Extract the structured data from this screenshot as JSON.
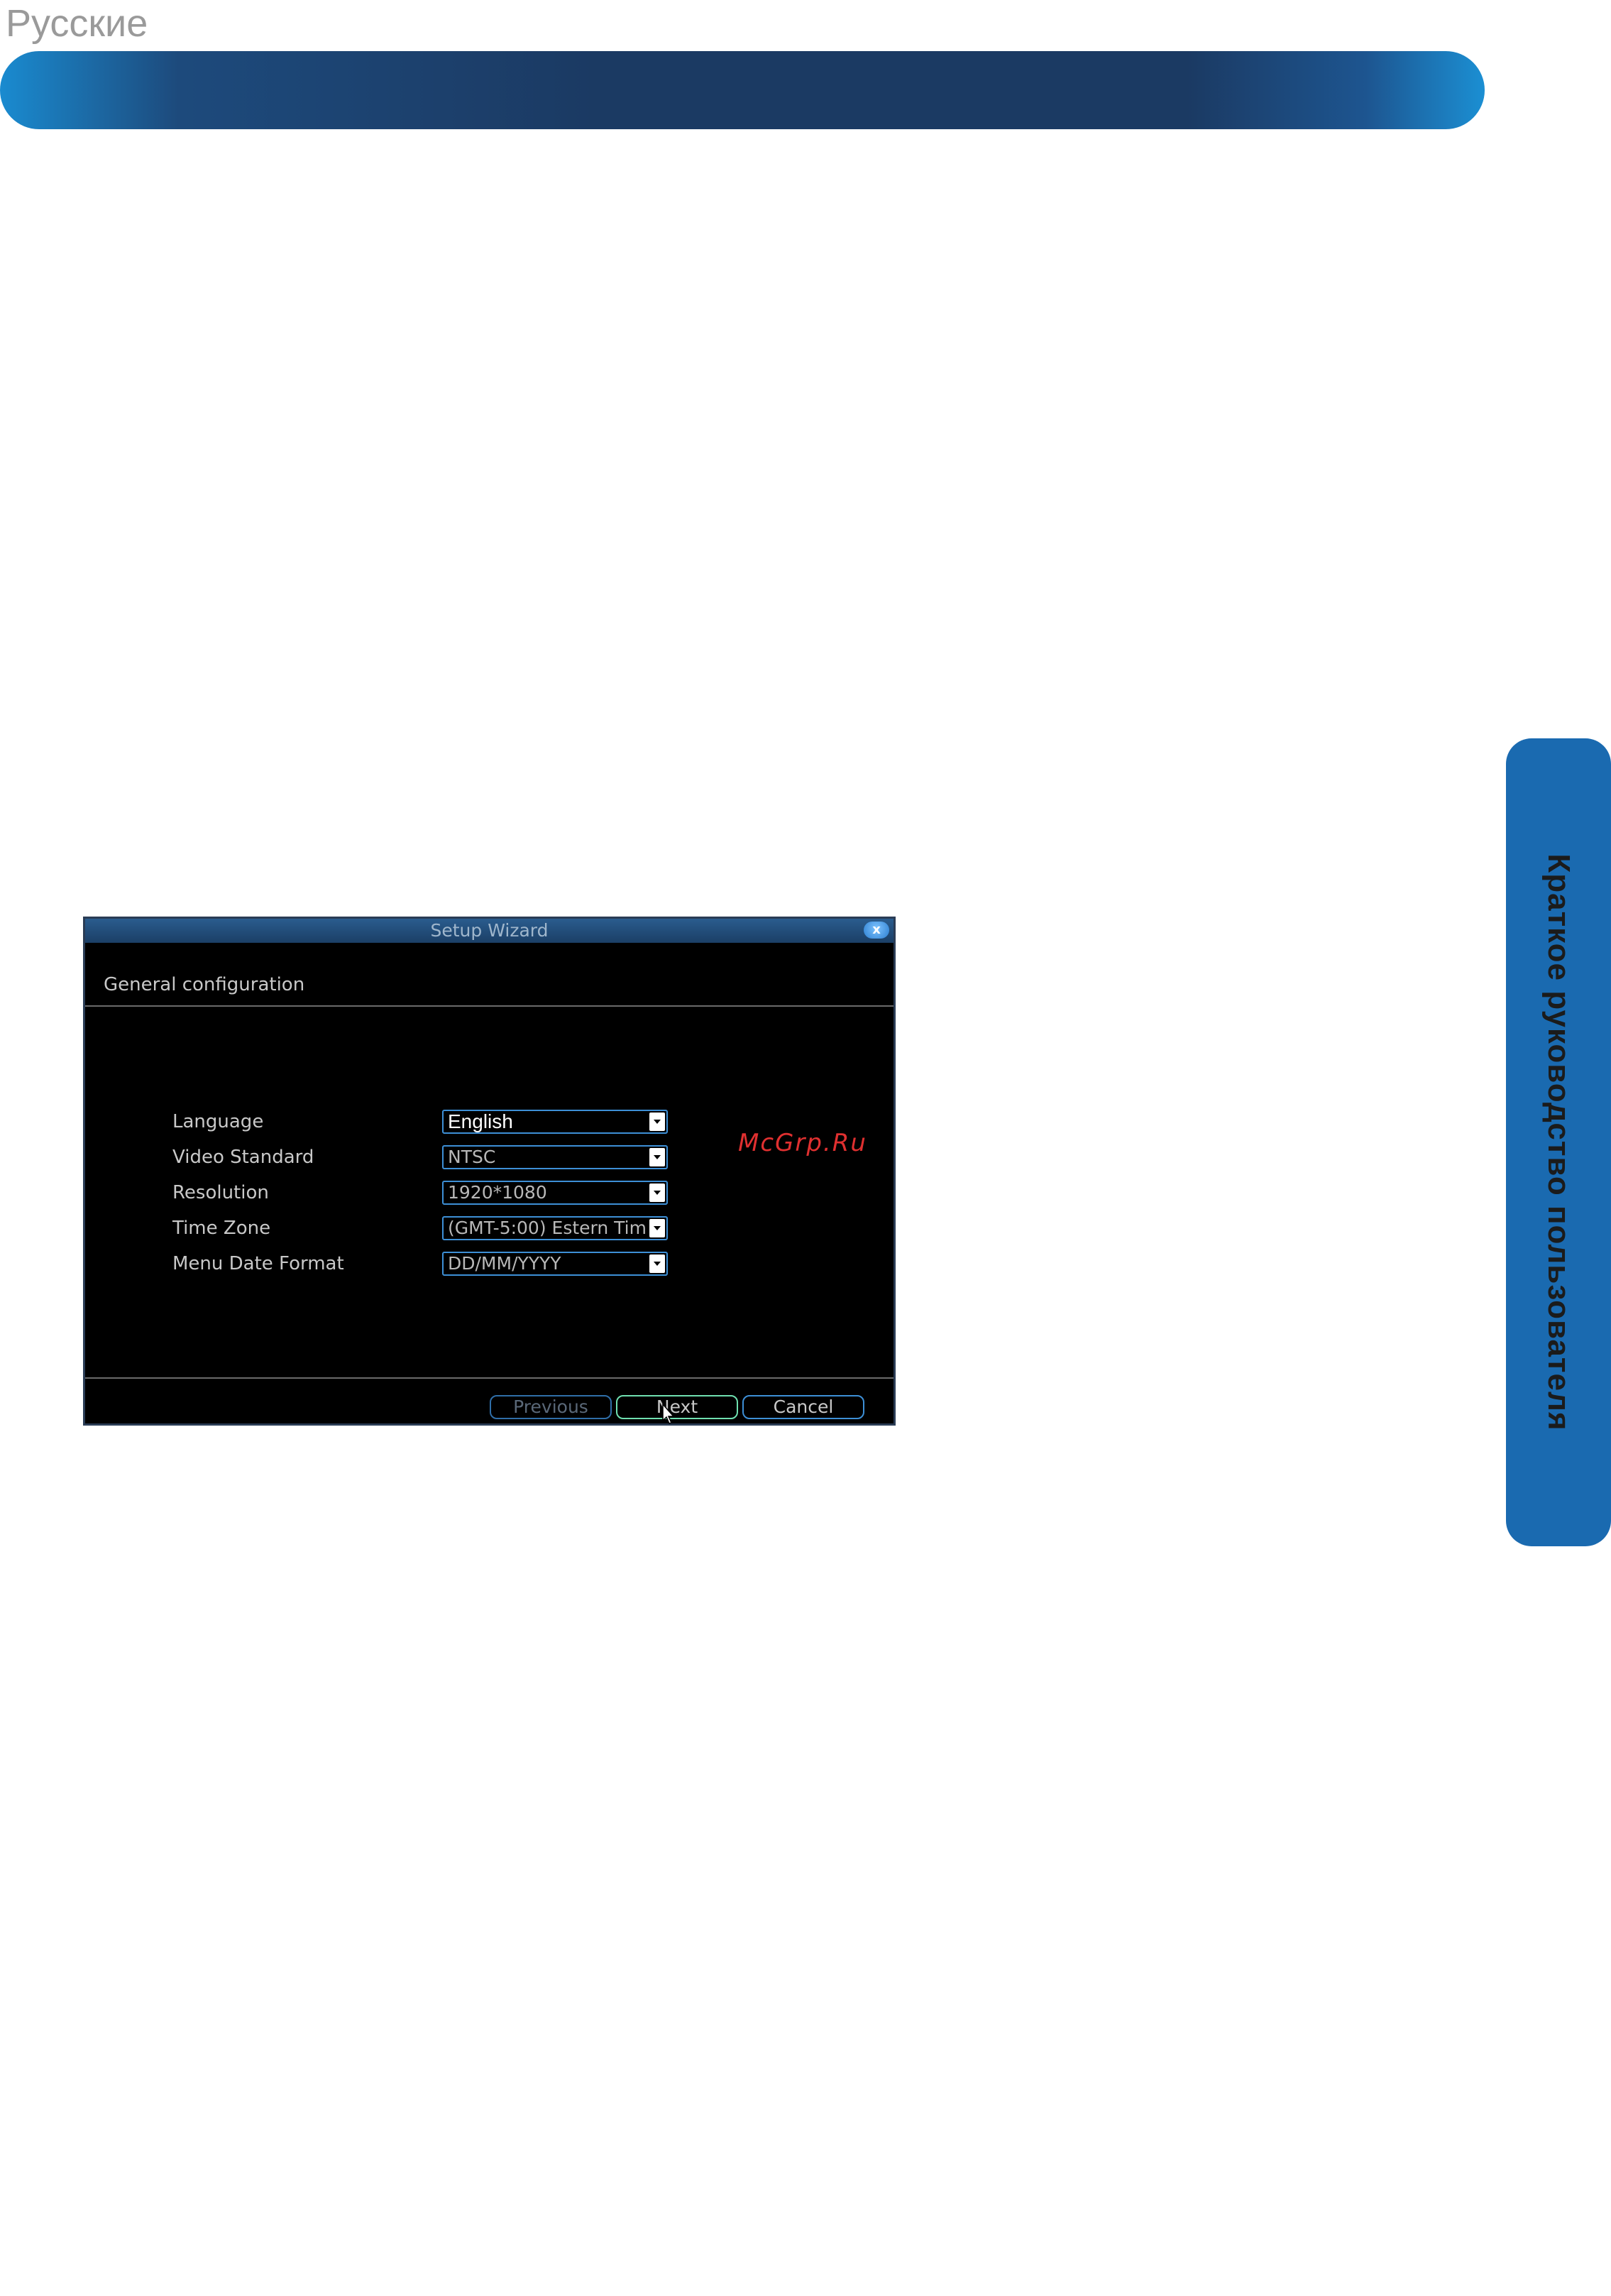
{
  "page": {
    "language": "Русские",
    "side_tab": "Краткое руководство пользователя"
  },
  "watermark": "McGrp.Ru",
  "window": {
    "title": "Setup Wizard",
    "close_symbol": "x",
    "section_title": "General configuration",
    "settings": [
      {
        "label": "Language",
        "value": "English"
      },
      {
        "label": "Video Standard",
        "value": "NTSC"
      },
      {
        "label": "Resolution",
        "value": "1920*1080"
      },
      {
        "label": "Time Zone",
        "value": "(GMT-5:00) Estern Tim"
      },
      {
        "label": "Menu Date Format",
        "value": "DD/MM/YYYY"
      }
    ],
    "buttons": {
      "previous": "Previous",
      "next": "Next",
      "cancel": "Cancel"
    }
  },
  "colors": {
    "banner": "#1b3a63",
    "side_tab": "#1a6ab0",
    "accent": "#3d8fd6",
    "next_highlight": "#6fe0b0"
  }
}
